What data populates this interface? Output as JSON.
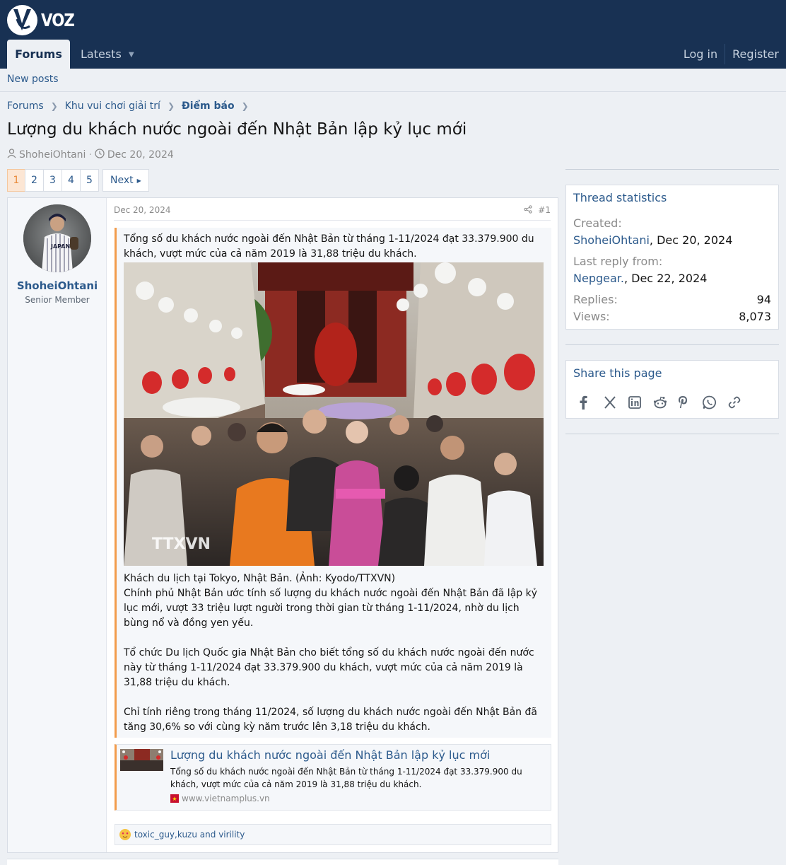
{
  "header": {
    "logo_text": "VOZ",
    "tabs": {
      "forums": "Forums",
      "latests": "Latests"
    },
    "login": "Log in",
    "register": "Register"
  },
  "subnav": {
    "new_posts": "New posts"
  },
  "breadcrumbs": [
    "Forums",
    "Khu vui chơi giải trí",
    "Điểm báo"
  ],
  "thread": {
    "title": "Lượng du khách nước ngoài đến Nhật Bản lập kỷ lục mới",
    "author": "ShoheiOhtani",
    "date": "Dec 20, 2024"
  },
  "pagination": {
    "pages": [
      "1",
      "2",
      "3",
      "4",
      "5"
    ],
    "current": "1",
    "next": "Next"
  },
  "post": {
    "username": "ShoheiOhtani",
    "user_title": "Senior Member",
    "date": "Dec 20, 2024",
    "number": "#1",
    "quote": {
      "intro": "Tổng số du khách nước ngoài đến Nhật Bản từ tháng 1-11/2024 đạt 33.379.900 du khách, vượt mức của cả năm 2019 là 31,88 triệu du khách.",
      "photo_watermark": "TTXVN",
      "caption": "Khách du lịch tại Tokyo, Nhật Bản. (Ảnh: Kyodo/TTXVN)",
      "para1": "Chính phủ Nhật Bản ước tính số lượng du khách nước ngoài đến Nhật Bản đã lập kỷ lục mới, vượt 33 triệu lượt người trong thời gian từ tháng 1-11/2024, nhờ du lịch bùng nổ và đồng yen yếu.",
      "para2": "Tổ chức Du lịch Quốc gia Nhật Bản cho biết tổng số du khách nước ngoài đến nước này từ tháng 1-11/2024 đạt 33.379.900 du khách, vượt mức của cả năm 2019 là 31,88 triệu du khách.",
      "para3": "Chỉ tính riêng trong tháng 11/2024, số lượng du khách nước ngoài đến Nhật Bản đã tăng 30,6% so với cùng kỳ năm trước lên 3,18 triệu du khách."
    },
    "unfurl": {
      "title": "Lượng du khách nước ngoài đến Nhật Bản lập kỷ lục mới",
      "description": "Tổng số du khách nước ngoài đến Nhật Bản từ tháng 1-11/2024 đạt 33.379.900 du khách, vượt mức của cả năm 2019 là 31,88 triệu du khách.",
      "site": "www.vietnamplus.vn"
    },
    "reactions": {
      "users": [
        "toxic_guy",
        "kuzu"
      ],
      "sep": ", ",
      "and_text": " and ",
      "last_user": "virility"
    }
  },
  "sidebar": {
    "stats": {
      "title": "Thread statistics",
      "created_label": "Created:",
      "created_user": "ShoheiOhtani",
      "created_date": ", Dec 20, 2024",
      "last_reply_label": "Last reply from:",
      "last_reply_user": "Nepgear.",
      "last_reply_date": ", Dec 22, 2024",
      "replies_label": "Replies:",
      "replies_value": "94",
      "views_label": "Views:",
      "views_value": "8,073"
    },
    "share": {
      "title": "Share this page",
      "icons": [
        "facebook-icon",
        "x-icon",
        "linkedin-icon",
        "reddit-icon",
        "pinterest-icon",
        "whatsapp-icon",
        "link-icon"
      ]
    }
  },
  "colors": {
    "header_bg": "#183153",
    "page_bg": "#edf0f4",
    "link": "#2c5a8c",
    "quote_accent": "#f29c4c"
  }
}
